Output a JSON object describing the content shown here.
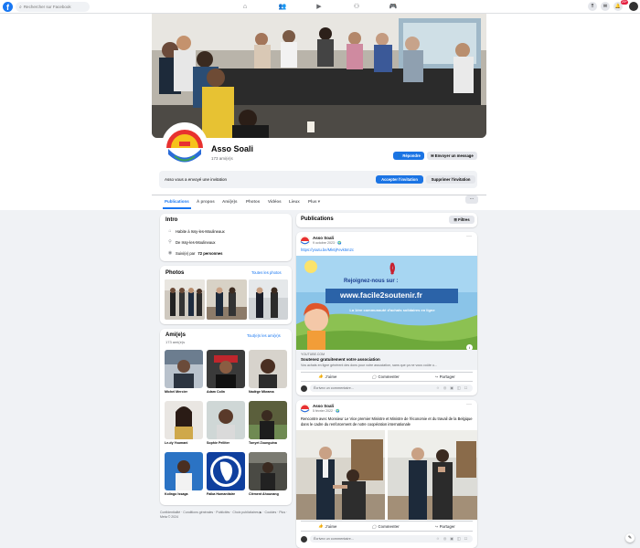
{
  "topbar": {
    "logo": "f",
    "search_placeholder": "Rechercher sur Facebook",
    "notification_count": "20+"
  },
  "page": {
    "name": "Asso Soali",
    "friend_count": "173 ami(e)s",
    "reply_button": "Répondre",
    "message_button": "Envoyer un message"
  },
  "invitation": {
    "text": "Asso vous a envoyé une invitation",
    "accept": "Accepter l'invitation",
    "delete": "Supprimer l'invitation"
  },
  "tabs": [
    {
      "label": "Publications"
    },
    {
      "label": "À propos"
    },
    {
      "label": "Ami(e)s"
    },
    {
      "label": "Photos"
    },
    {
      "label": "Vidéos"
    },
    {
      "label": "Lieux"
    },
    {
      "label": "Plus ▾"
    }
  ],
  "more_button": "···",
  "intro": {
    "title": "Intro",
    "lives_in": "Habite à Issy-les-Moulineaux",
    "from": "De Issy-les-Moulineaux",
    "followed_prefix": "Suivi(e) par",
    "followed_count": "72 personnes"
  },
  "photos": {
    "title": "Photos",
    "see_all": "Toutes les photos"
  },
  "friends": {
    "title": "Ami(e)s",
    "count": "173 ami(e)s",
    "see_all": "Tout(e)s les ami(e)s",
    "list": [
      {
        "name": "Michel Mercier"
      },
      {
        "name": "Adam Colin"
      },
      {
        "name": "Nadège Mkrama"
      },
      {
        "name": "Le-dy Youmani"
      },
      {
        "name": "Sophie Pelliter"
      },
      {
        "name": "Tonyet Zounguina"
      },
      {
        "name": "Kolingo Issaga"
      },
      {
        "name": "Faiba Humanitaire"
      },
      {
        "name": "Clément Ahounang"
      }
    ]
  },
  "footer": "Confidentialité · Conditions générales · Publicités · Choix publicitaires ▶ · Cookies · Plus · Meta © 2024",
  "feed": {
    "title": "Publications",
    "filters": "Filtres"
  },
  "posts": [
    {
      "author": "Asso Soali",
      "date": "9 octobre 2023 · 🌍",
      "link": "https://youtu.be/Mk6jFevk5m2c",
      "banner_title": "Rejoignez-nous sur :",
      "banner_url": "www.facile2soutenir.fr",
      "banner_sub": "La 1ère communauté d'achats solidaires en ligne",
      "link_domain": "YOUTUBE.COM",
      "link_title": "Soutenez gratuitement votre association",
      "link_desc": "Vos achats en ligne génèrent des dons pour votre association, sans que ça ne vous coûte u...",
      "like": "J'aime",
      "comment": "Commenter",
      "share": "Partager",
      "comment_placeholder": "Écrivez un commentaire..."
    },
    {
      "author": "Asso Soali",
      "date": "5 février 2022 · 🌍",
      "text": "Rencontre avec Monsieur Le Vice premier Ministre et Ministre de l'économie et du travail de la Belgique dans le cadre du renforcement de notre coopération internationale",
      "like": "J'aime",
      "comment": "Commenter",
      "share": "Partager",
      "comment_placeholder": "Écrivez un commentaire..."
    }
  ],
  "colors": {
    "accent": "#1877f2",
    "background": "#f0f2f5"
  }
}
